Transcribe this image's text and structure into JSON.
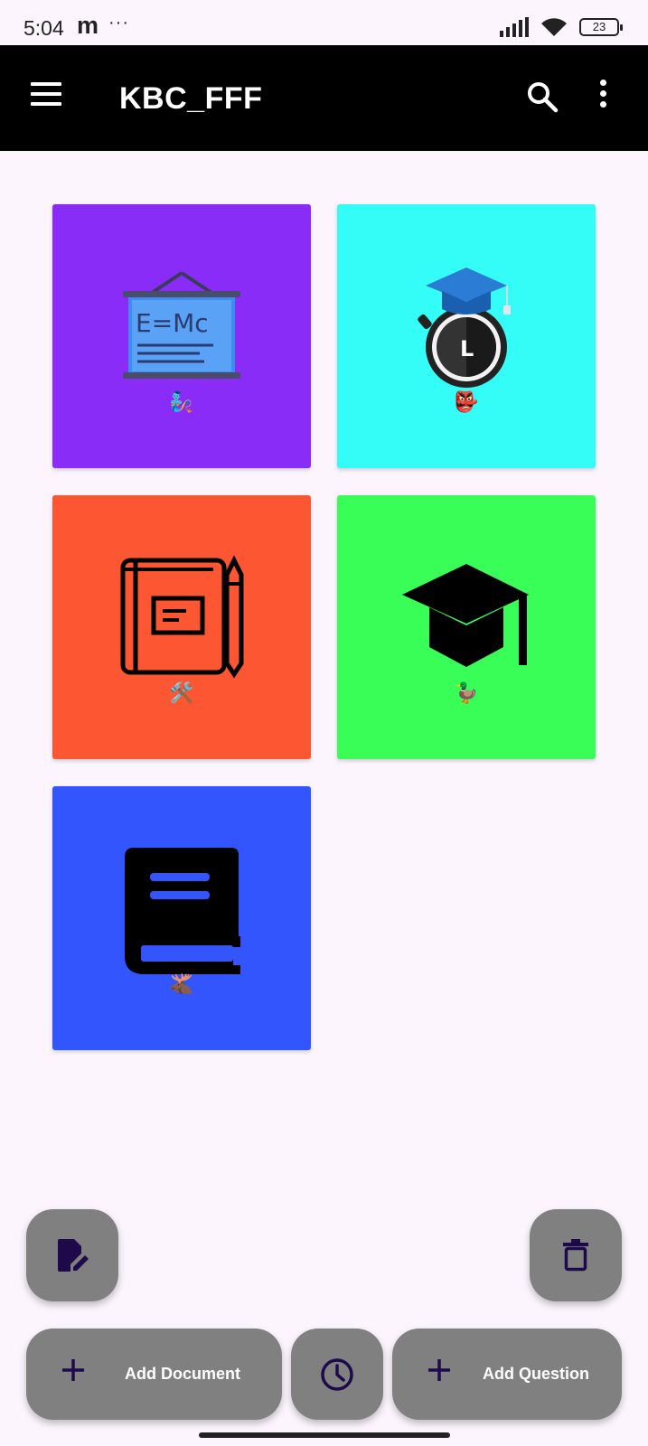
{
  "status_bar": {
    "time": "5:04",
    "app_glyph": "m",
    "overflow": "···",
    "battery": "23"
  },
  "app_bar": {
    "title": "KBC_FFF",
    "icons": [
      "menu-icon",
      "search-icon",
      "more-vert-icon"
    ]
  },
  "cards": [
    {
      "color": "#8a2cf8",
      "illustration": "blackboard-emc-icon",
      "emoji": "🧞",
      "board_text": "E=Mc"
    },
    {
      "color": "#33fdf6",
      "illustration": "stopwatch-graduation-cap-icon",
      "emoji": "👺",
      "watch_letter": "L"
    },
    {
      "color": "#fd5632",
      "illustration": "notebook-pencil-icon",
      "emoji": "🛠️"
    },
    {
      "color": "#39fe58",
      "illustration": "graduation-cap-icon",
      "emoji": "🦆"
    },
    {
      "color": "#3355fd",
      "illustration": "book-icon",
      "emoji": "🫎"
    }
  ],
  "fabs": {
    "edit": {
      "icon": "edit-document-icon"
    },
    "delete": {
      "icon": "trash-icon"
    },
    "add_document": {
      "label": "Add Document",
      "icon": "plus-icon"
    },
    "history": {
      "icon": "clock-icon"
    },
    "add_question": {
      "label": "Add Question",
      "icon": "plus-icon"
    }
  },
  "colors": {
    "background": "#fcf5fd",
    "app_bar": "#000000",
    "fab": "#808080",
    "fab_icon": "#1e0a4a"
  }
}
